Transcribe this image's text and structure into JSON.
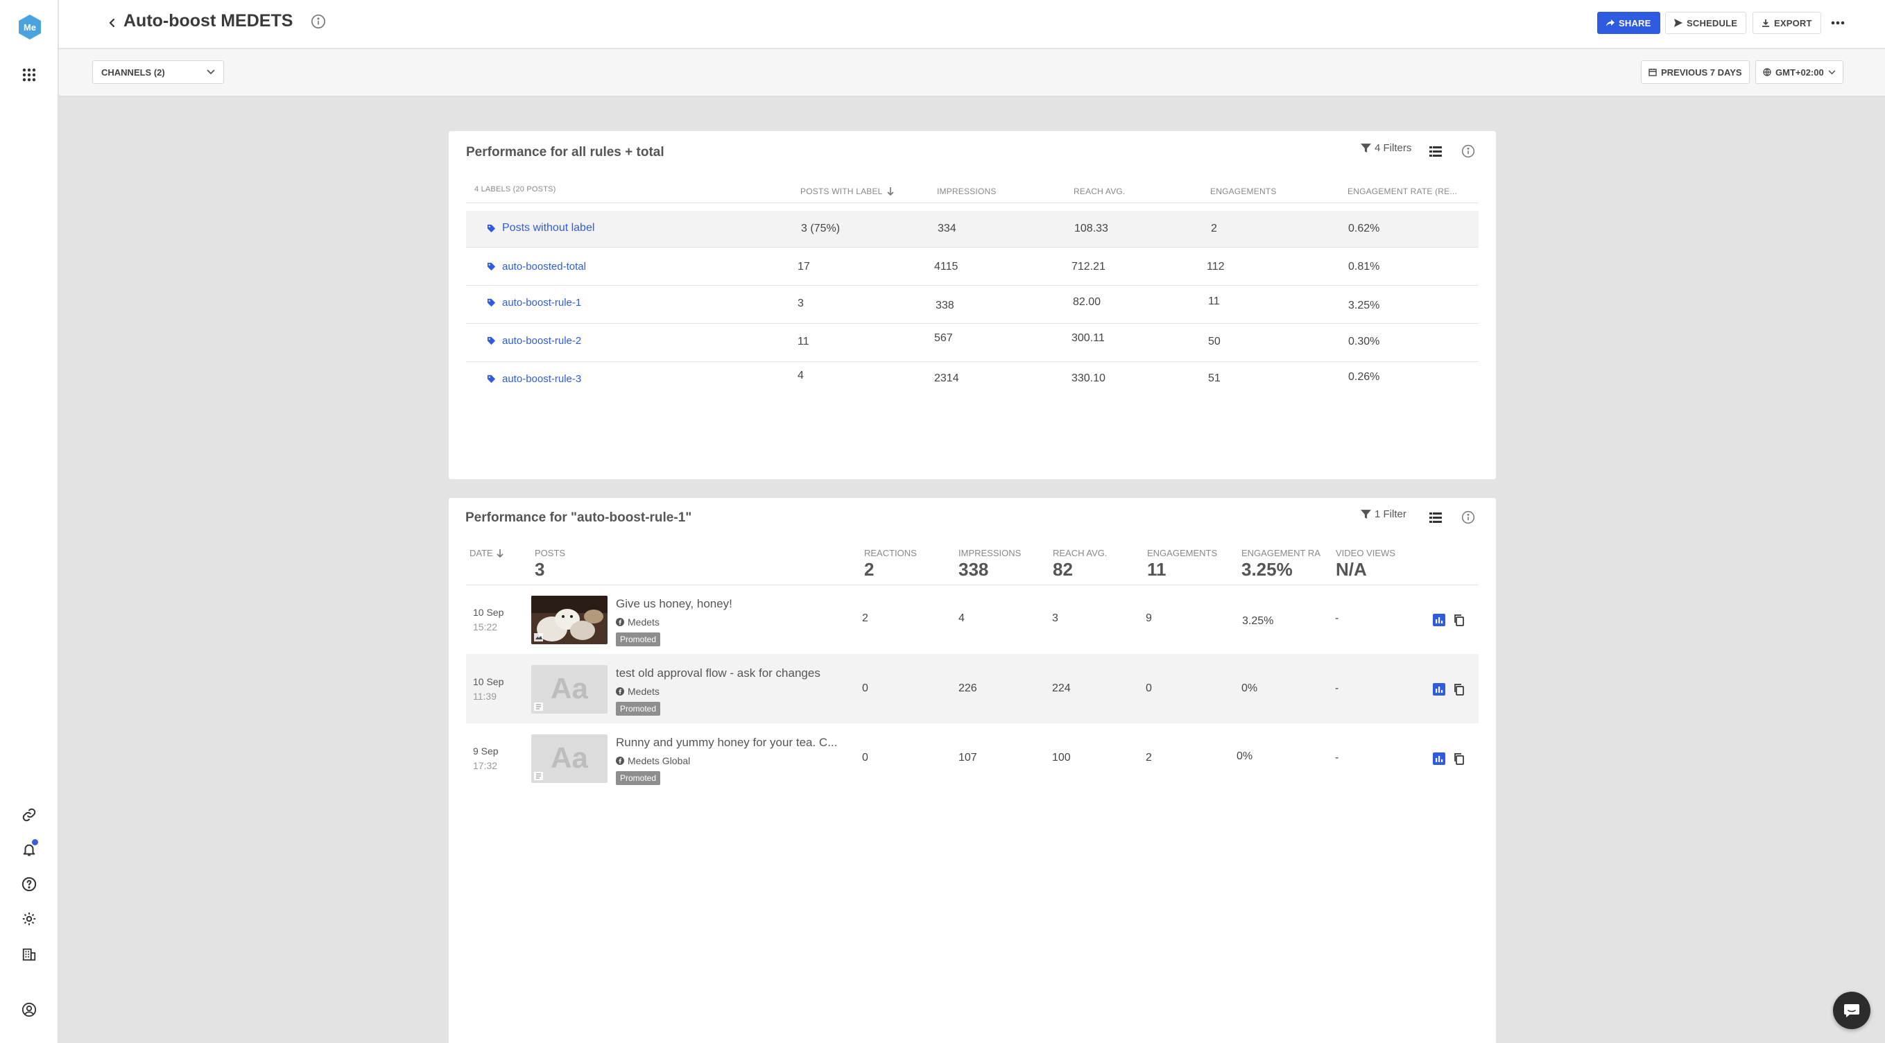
{
  "app": {
    "logo_text": "Me"
  },
  "header": {
    "title": "Auto-boost MEDETS",
    "share_label": "SHARE",
    "schedule_label": "SCHEDULE",
    "export_label": "EXPORT"
  },
  "subbar": {
    "channels_label": "CHANNELS (2)",
    "date_range_label": "PREVIOUS 7 DAYS",
    "timezone_label": "GMT+02:00"
  },
  "summary_card": {
    "title": "Performance for all rules + total",
    "filter_label": "4 Filters",
    "columns": {
      "labels": "4 LABELS (20 POSTS)",
      "posts_with_label": "POSTS WITH LABEL",
      "impressions": "IMPRESSIONS",
      "reach_avg": "REACH AVG.",
      "engagements": "ENGAGEMENTS",
      "engagement_rate": "ENGAGEMENT RATE (RE..."
    },
    "rows": [
      {
        "label": "Posts without label",
        "posts": "3 (75%)",
        "impressions": "334",
        "reach": "108.33",
        "engagements": "2",
        "rate": "0.62%"
      },
      {
        "label": "auto-boosted-total",
        "posts": "17",
        "impressions": "4115",
        "reach": "712.21",
        "engagements": "112",
        "rate": "0.81%"
      },
      {
        "label": "auto-boost-rule-1",
        "posts": "3",
        "impressions": "338",
        "reach": "82.00",
        "engagements": "11",
        "rate": "3.25%"
      },
      {
        "label": "auto-boost-rule-2",
        "posts": "11",
        "impressions": "567",
        "reach": "300.11",
        "engagements": "50",
        "rate": "0.30%"
      },
      {
        "label": "auto-boost-rule-3",
        "posts": "4",
        "impressions": "2314",
        "reach": "330.10",
        "engagements": "51",
        "rate": "0.26%"
      }
    ]
  },
  "detail_card": {
    "title": "Performance for \"auto-boost-rule-1\"",
    "filter_label": "1 Filter",
    "columns": {
      "date": "DATE",
      "posts": "POSTS",
      "posts_total": "3",
      "reactions": "REACTIONS",
      "reactions_total": "2",
      "impressions": "IMPRESSIONS",
      "impressions_total": "338",
      "reach": "REACH AVG.",
      "reach_total": "82",
      "engagements": "ENGAGEMENTS",
      "engagements_total": "11",
      "rate": "ENGAGEMENT RA",
      "rate_total": "3.25%",
      "video": "VIDEO VIEWS",
      "video_total": "N/A"
    },
    "rows": [
      {
        "date": "10 Sep",
        "time": "15:22",
        "title": "Give us honey, honey!",
        "channel": "Medets",
        "badge": "Promoted",
        "thumb": "photo",
        "reactions": "2",
        "impressions": "4",
        "reach": "3",
        "engagements": "9",
        "rate": "3.25%",
        "video": "-"
      },
      {
        "date": "10 Sep",
        "time": "11:39",
        "title": "test old approval flow - ask for changes",
        "channel": "Medets",
        "badge": "Promoted",
        "thumb_text": "Aa",
        "reactions": "0",
        "impressions": "226",
        "reach": "224",
        "engagements": "0",
        "rate": "0%",
        "video": "-"
      },
      {
        "date": "9 Sep",
        "time": "17:32",
        "title": "Runny and yummy honey for your tea. C...",
        "channel": "Medets Global",
        "badge": "Promoted",
        "thumb_text": "Aa",
        "reactions": "0",
        "impressions": "107",
        "reach": "100",
        "engagements": "2",
        "rate": "0%",
        "video": "-"
      }
    ]
  },
  "colors": {
    "accent": "#2f5be0",
    "logo": "#4aa3df",
    "background": "#e3e3e3",
    "badge": "#8e8e8e"
  }
}
